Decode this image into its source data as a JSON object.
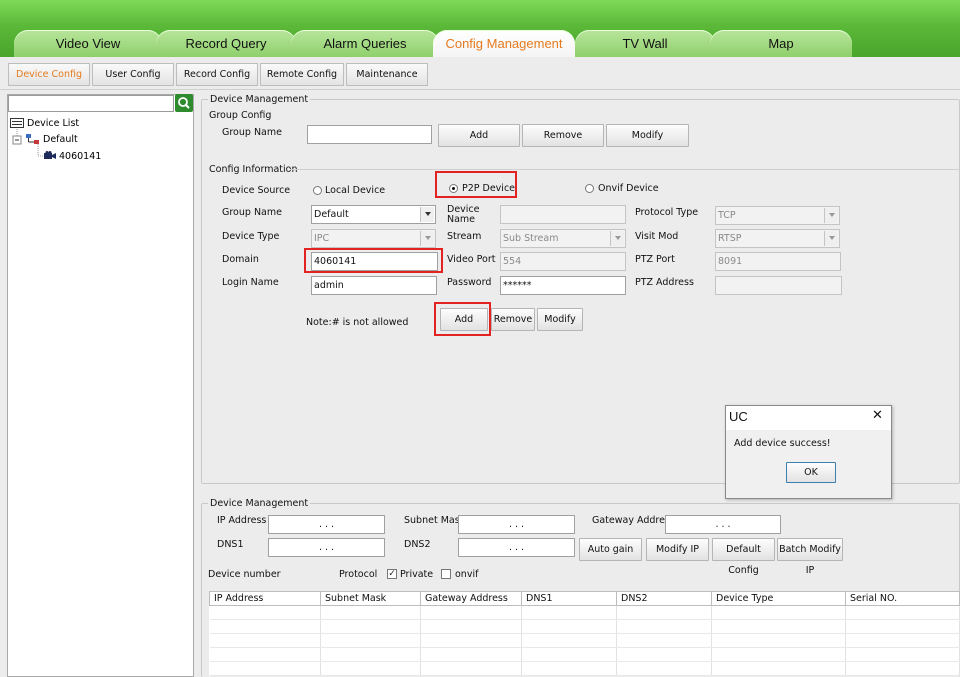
{
  "main_tabs": [
    "Video View",
    "Record Query",
    "Alarm Queries",
    "Config Management",
    "TV Wall",
    "Map"
  ],
  "sub_tabs": [
    "Device Config",
    "User Config",
    "Record Config",
    "Remote Config",
    "Maintenance"
  ],
  "search": {
    "value": ""
  },
  "tree": {
    "root": "Device List",
    "group": "Default",
    "device": "4060141"
  },
  "device_management": {
    "title": "Device Management",
    "group_config": {
      "title": "Group Config",
      "group_name_label": "Group Name",
      "group_name_value": "",
      "add": "Add",
      "remove": "Remove",
      "modify": "Modify"
    },
    "config_info": {
      "title": "Config Information",
      "device_source_label": "Device Source",
      "sources": [
        "Local Device",
        "P2P Device",
        "Onvif Device"
      ],
      "selected_source": "P2P Device",
      "group_name_label": "Group Name",
      "group_name_value": "Default",
      "device_name_label": "Device Name",
      "device_name_value": "",
      "protocol_type_label": "Protocol Type",
      "protocol_type_value": "TCP",
      "device_type_label": "Device Type",
      "device_type_value": "IPC",
      "stream_label": "Stream",
      "stream_value": "Sub Stream",
      "visit_mod_label": "Visit Mod",
      "visit_mod_value": "RTSP",
      "domain_label": "Domain",
      "domain_value": "4060141",
      "video_port_label": "Video Port",
      "video_port_value": "554",
      "ptz_port_label": "PTZ Port",
      "ptz_port_value": "8091",
      "login_name_label": "Login Name",
      "login_name_value": "admin",
      "password_label": "Password",
      "password_value": "******",
      "ptz_address_label": "PTZ Address",
      "ptz_address_value": "",
      "note": "Note:# is not allowed",
      "add": "Add",
      "remove": "Remove",
      "modify": "Modify"
    }
  },
  "network": {
    "title": "Device Management",
    "ip_label": "IP Address",
    "subnet_label": "Subnet Mask",
    "gateway_label": "Gateway Address",
    "dns1_label": "DNS1",
    "dns2_label": "DNS2",
    "ip_placeholder": ".    .    .",
    "buttons": [
      "Auto gain",
      "Modify IP",
      "Default Config",
      "Batch Modify IP"
    ],
    "device_number_label": "Device number",
    "protocol_label": "Protocol",
    "private_label": "Private",
    "private_checked": true,
    "onvif_label": "onvif",
    "onvif_checked": false,
    "columns": [
      "IP Address",
      "Subnet Mask",
      "Gateway Address",
      "DNS1",
      "DNS2",
      "Device Type",
      "Serial NO."
    ]
  },
  "dialog": {
    "title": "UC",
    "message": "Add device success!",
    "ok": "OK",
    "close": "✕"
  },
  "colors": {
    "accent": "#e57a1e",
    "highlight": "#e32222",
    "header_green": "#5bb838"
  }
}
